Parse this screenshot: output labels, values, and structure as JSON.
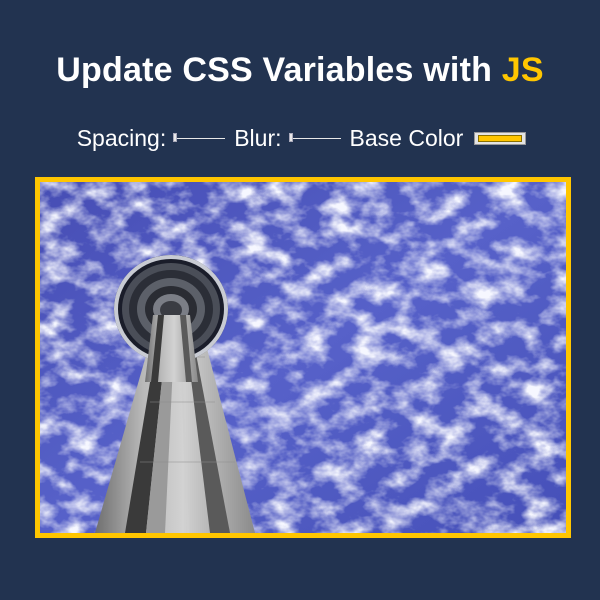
{
  "header": {
    "title_main": "Update CSS Variables with ",
    "title_highlight": "JS"
  },
  "controls": {
    "spacing_label": "Spacing:",
    "spacing_value": 0,
    "blur_label": "Blur:",
    "blur_value": 0,
    "base_color_label": "Base Color",
    "base_color_value": "#ffc600"
  },
  "colors": {
    "background": "#223350",
    "accent": "#ffc600"
  },
  "image": {
    "subject": "cn-tower-against-cloudy-sky"
  }
}
